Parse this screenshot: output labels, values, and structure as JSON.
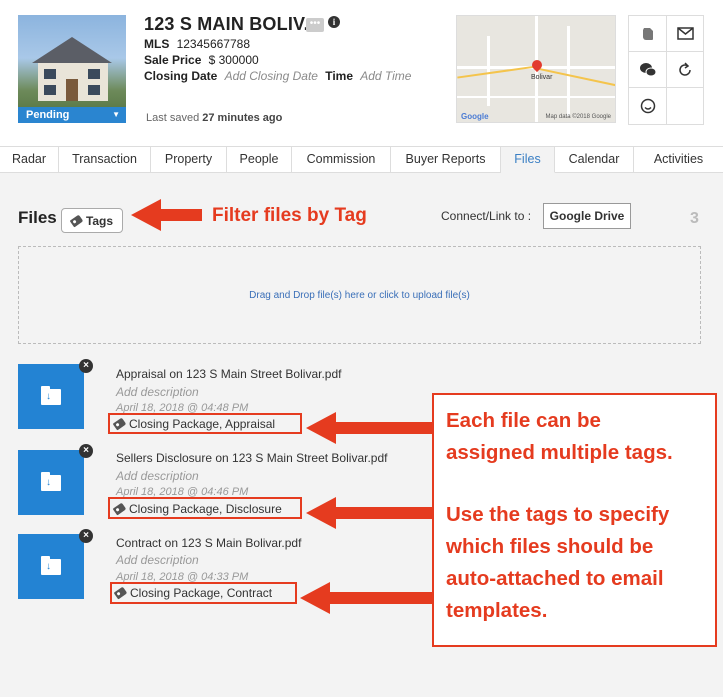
{
  "listing": {
    "title": "123 S MAIN BOLIV...",
    "status": "Pending",
    "mls_label": "MLS",
    "mls_value": "12345667788",
    "sale_price_label": "Sale Price",
    "sale_price_value": "$ 300000",
    "closing_date_label": "Closing Date",
    "closing_date_placeholder": "Add Closing Date",
    "time_label": "Time",
    "time_placeholder": "Add Time",
    "last_saved_prefix": "Last saved",
    "last_saved_value": "27 minutes ago"
  },
  "map": {
    "logo": "Google",
    "attribution": "Map data ©2018 Google",
    "label": "Bolivar"
  },
  "actions": [
    "evernote-icon",
    "mail-icon",
    "chat-icon",
    "refresh-icon",
    "smile-icon"
  ],
  "tabs": [
    {
      "label": "Radar",
      "active": false
    },
    {
      "label": "Transaction",
      "active": false
    },
    {
      "label": "Property",
      "active": false
    },
    {
      "label": "People",
      "active": false
    },
    {
      "label": "Commission",
      "active": false
    },
    {
      "label": "Buyer Reports",
      "active": false
    },
    {
      "label": "Files",
      "active": true
    },
    {
      "label": "Calendar",
      "active": false
    },
    {
      "label": "Activities",
      "active": false
    }
  ],
  "files_section": {
    "title": "Files",
    "tags_button": "Tags",
    "connect_label": "Connect/Link to :",
    "gdrive_button": "Google Drive",
    "count": "3",
    "dropzone_text": "Drag and Drop file(s) here or click to upload file(s)"
  },
  "files": [
    {
      "name": "Appraisal on 123 S Main Street Bolivar.pdf",
      "description_placeholder": "Add description",
      "date": "April 18, 2018 @ 04:48 PM",
      "tags": "Closing Package, Appraisal"
    },
    {
      "name": "Sellers Disclosure on 123 S Main Street Bolivar.pdf",
      "description_placeholder": "Add description",
      "date": "April 18, 2018 @ 04:46 PM",
      "tags": "Closing Package, Disclosure"
    },
    {
      "name": "Contract on 123 S Main Bolivar.pdf",
      "description_placeholder": "Add description",
      "date": "April 18, 2018 @ 04:33 PM",
      "tags": "Closing Package, Contract"
    }
  ],
  "annotations": {
    "filter_label": "Filter files by Tag",
    "callout_line1": "Each file can be",
    "callout_line2": "assigned multiple tags.",
    "callout_line3": "Use the tags to specify",
    "callout_line4": "which files should be",
    "callout_line5": "auto-attached to email",
    "callout_line6": "templates.",
    "color": "#e53b1f"
  },
  "colors": {
    "accent": "#2383d3",
    "active_tab": "#3a7fc4",
    "status_bg": "#2a85d0"
  }
}
